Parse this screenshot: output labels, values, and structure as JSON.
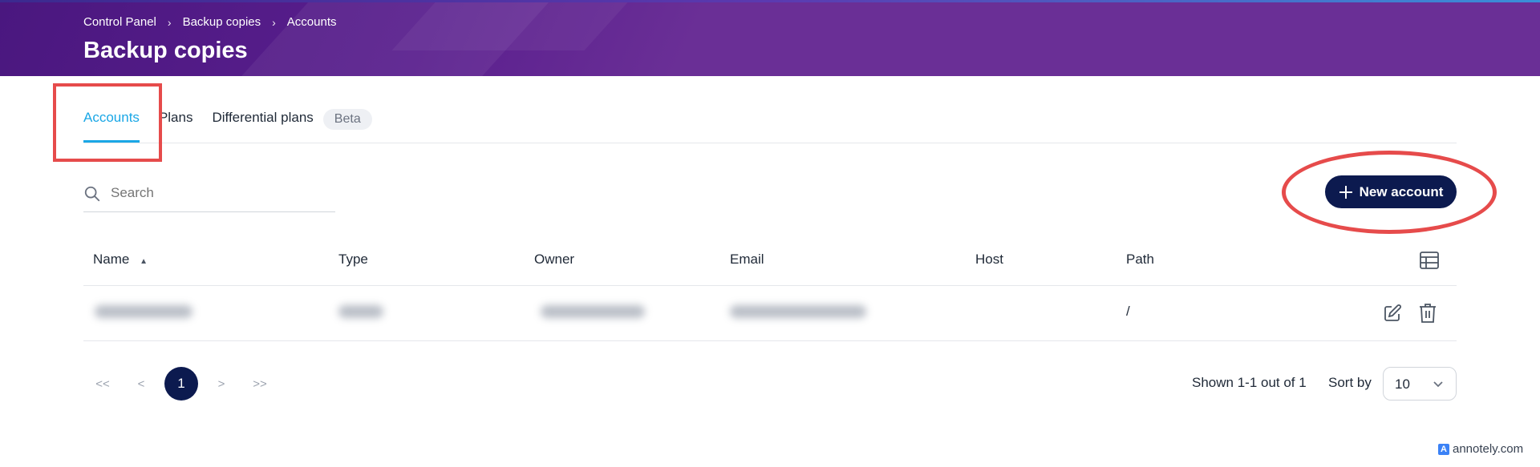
{
  "header": {
    "breadcrumb": [
      "Control Panel",
      "Backup copies",
      "Accounts"
    ],
    "breadcrumb_sep": "›",
    "title": "Backup copies"
  },
  "tabs": [
    {
      "label": "Accounts",
      "active": true
    },
    {
      "label": "Plans",
      "active": false
    },
    {
      "label": "Differential plans",
      "active": false
    }
  ],
  "beta_badge": "Beta",
  "search": {
    "placeholder": "Search",
    "icon": "search-icon"
  },
  "new_account_button": {
    "label": "New account",
    "icon": "plus-icon"
  },
  "table": {
    "columns": [
      "Name",
      "Type",
      "Owner",
      "Email",
      "Host",
      "Path"
    ],
    "sort_indicator": "▲",
    "rows": [
      {
        "path": "/"
      }
    ],
    "column_settings_icon": "table-settings-icon"
  },
  "pagination": {
    "first": "<<",
    "prev": "<",
    "current": "1",
    "next": ">",
    "last": ">>",
    "shown_text": "Shown 1-1 out of 1",
    "sort_by_label": "Sort by",
    "page_size": "10"
  },
  "watermark": {
    "logo": "A",
    "text": "annotely.com"
  },
  "colors": {
    "header": "#6a2f96",
    "accent": "#1aa7e6",
    "primary_button": "#0c1a4f",
    "annotation": "#e64b4b"
  }
}
